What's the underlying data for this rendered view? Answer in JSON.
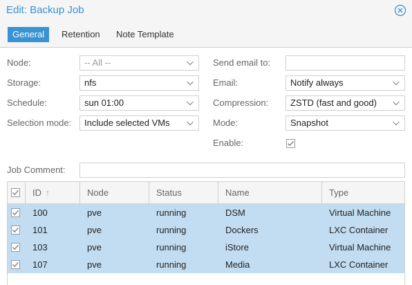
{
  "window": {
    "title": "Edit: Backup Job"
  },
  "tabs": [
    "General",
    "Retention",
    "Note Template"
  ],
  "form": {
    "node": {
      "label": "Node:",
      "value": "-- All --"
    },
    "storage": {
      "label": "Storage:",
      "value": "nfs"
    },
    "schedule": {
      "label": "Schedule:",
      "value": "sun 01:00"
    },
    "selection_mode": {
      "label": "Selection mode:",
      "value": "Include selected VMs"
    },
    "send_email_to": {
      "label": "Send email to:",
      "value": ""
    },
    "email": {
      "label": "Email:",
      "value": "Notify always"
    },
    "compression": {
      "label": "Compression:",
      "value": "ZSTD (fast and good)"
    },
    "mode": {
      "label": "Mode:",
      "value": "Snapshot"
    },
    "enable": {
      "label": "Enable:",
      "checked": true
    },
    "job_comment": {
      "label": "Job Comment:",
      "value": ""
    }
  },
  "grid": {
    "columns": [
      "ID",
      "Node",
      "Status",
      "Name",
      "Type"
    ],
    "sort_indicator": "↑",
    "rows": [
      {
        "selected": true,
        "id": "100",
        "node": "pve",
        "status": "running",
        "name": "DSM",
        "type": "Virtual Machine"
      },
      {
        "selected": true,
        "id": "101",
        "node": "pve",
        "status": "running",
        "name": "Dockers",
        "type": "LXC Container"
      },
      {
        "selected": true,
        "id": "103",
        "node": "pve",
        "status": "running",
        "name": "iStore",
        "type": "Virtual Machine"
      },
      {
        "selected": true,
        "id": "107",
        "node": "pve",
        "status": "running",
        "name": "Media",
        "type": "LXC Container"
      }
    ]
  },
  "colors": {
    "accent": "#3892d4",
    "selected_row": "#c2ddf2",
    "border": "#cfcfcf"
  }
}
